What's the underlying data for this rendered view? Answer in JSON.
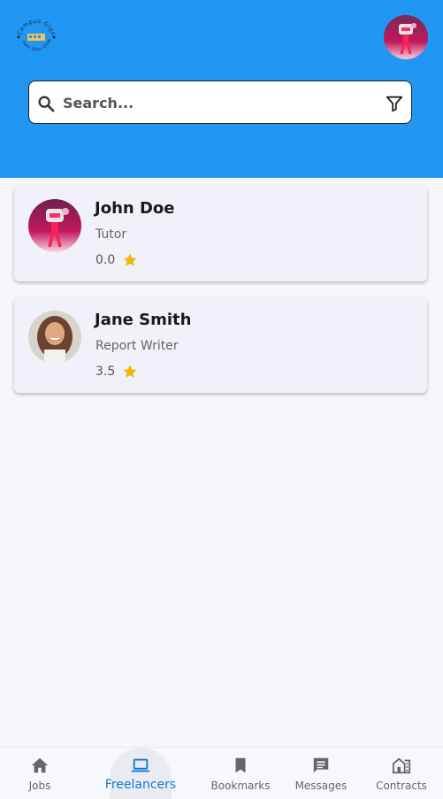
{
  "header": {
    "logo_text": [
      "Campus Gigs",
      "Learn, Earn, Grow"
    ],
    "background_color": "#2196f3"
  },
  "search": {
    "placeholder": "Search..."
  },
  "freelancers": [
    {
      "name": "John Doe",
      "role": "Tutor",
      "rating": "0.0",
      "avatar": "avatar-robot"
    },
    {
      "name": "Jane Smith",
      "role": "Report Writer",
      "rating": "3.5",
      "avatar": "avatar-photo"
    }
  ],
  "nav": {
    "items": [
      {
        "label": "Jobs",
        "icon": "home-icon"
      },
      {
        "label": "Freelancers",
        "icon": "laptop-icon",
        "active": true
      },
      {
        "label": "Bookmarks",
        "icon": "bookmark-icon"
      },
      {
        "label": "Messages",
        "icon": "message-icon"
      },
      {
        "label": "Contracts",
        "icon": "contracts-icon"
      }
    ]
  },
  "colors": {
    "accent": "#1976d2",
    "star": "#f5b400",
    "card_bg": "#f0f1f9"
  }
}
